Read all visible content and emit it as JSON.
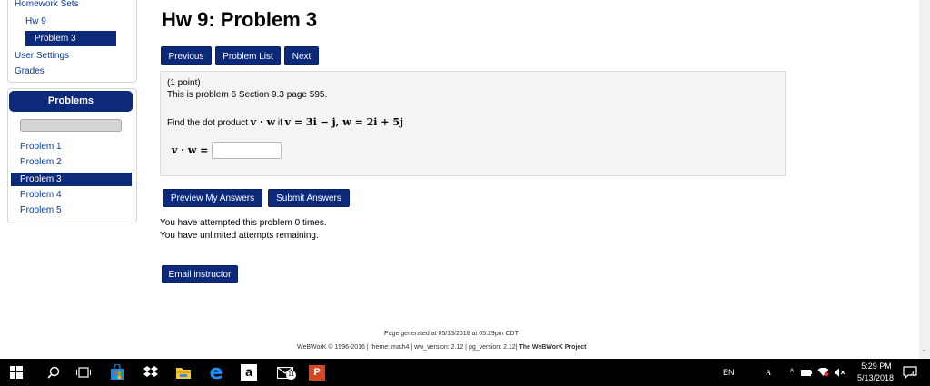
{
  "sidebar": {
    "homework_sets": "Homework Sets",
    "hw9": "Hw 9",
    "problem3": "Problem 3",
    "user_settings": "User Settings",
    "grades": "Grades",
    "problems_title": "Problems",
    "problems": [
      "Problem 1",
      "Problem 2",
      "Problem 3",
      "Problem 4",
      "Problem 5"
    ]
  },
  "page": {
    "title": "Hw 9: Problem 3",
    "nav": {
      "previous": "Previous",
      "problem_list": "Problem List",
      "next": "Next"
    }
  },
  "problem": {
    "points": "(1 point)",
    "source": "This is problem 6 Section 9.3 page 595.",
    "prompt_prefix": "Find the dot product ",
    "prompt_vw": "v · w",
    "prompt_if": " if ",
    "prompt_v": "v = 3i − j, w = 2i + 5j",
    "answer_label": "v · w =",
    "answer_value": ""
  },
  "actions": {
    "preview": "Preview My Answers",
    "submit": "Submit Answers",
    "attempts": "You have attempted this problem 0 times.",
    "remaining": "You have unlimited attempts remaining.",
    "email": "Email instructor"
  },
  "footer": {
    "generated": "Page generated at 05/13/2018 at 05:29pm CDT",
    "versions": "WeBWorK © 1996-2016 | theme: math4 | ww_version: 2.12 | pg_version: 2.12|",
    "project": "The WeBWorK Project"
  },
  "taskbar": {
    "language": "EN",
    "time": "5:29 PM",
    "date": "5/13/2018",
    "mail_badge": "11",
    "notification_count": "4",
    "icons": [
      "windows-start-icon",
      "search-icon",
      "task-view-icon",
      "store-icon",
      "dropbox-icon",
      "file-explorer-icon",
      "edge-icon",
      "amazon-icon",
      "mail-icon",
      "powerpoint-icon"
    ]
  },
  "colors": {
    "nav_blue": "#0d2a7a",
    "link_blue": "#0a3a8c",
    "panel_gray": "#f4f4f4"
  }
}
